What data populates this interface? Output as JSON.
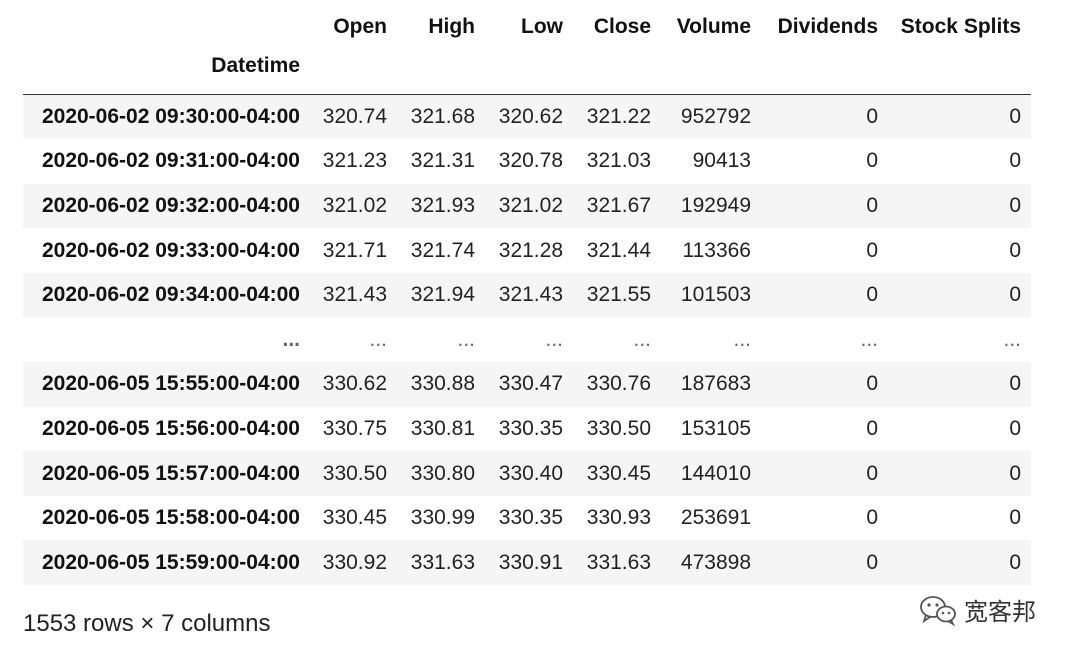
{
  "table": {
    "index_name": "Datetime",
    "columns": [
      "Open",
      "High",
      "Low",
      "Close",
      "Volume",
      "Dividends",
      "Stock Splits"
    ],
    "rows": [
      {
        "index": "2020-06-02 09:30:00-04:00",
        "values": [
          "320.74",
          "321.68",
          "320.62",
          "321.22",
          "952792",
          "0",
          "0"
        ]
      },
      {
        "index": "2020-06-02 09:31:00-04:00",
        "values": [
          "321.23",
          "321.31",
          "320.78",
          "321.03",
          "90413",
          "0",
          "0"
        ]
      },
      {
        "index": "2020-06-02 09:32:00-04:00",
        "values": [
          "321.02",
          "321.93",
          "321.02",
          "321.67",
          "192949",
          "0",
          "0"
        ]
      },
      {
        "index": "2020-06-02 09:33:00-04:00",
        "values": [
          "321.71",
          "321.74",
          "321.28",
          "321.44",
          "113366",
          "0",
          "0"
        ]
      },
      {
        "index": "2020-06-02 09:34:00-04:00",
        "values": [
          "321.43",
          "321.94",
          "321.43",
          "321.55",
          "101503",
          "0",
          "0"
        ]
      },
      {
        "index": "...",
        "values": [
          "...",
          "...",
          "...",
          "...",
          "...",
          "...",
          "..."
        ]
      },
      {
        "index": "2020-06-05 15:55:00-04:00",
        "values": [
          "330.62",
          "330.88",
          "330.47",
          "330.76",
          "187683",
          "0",
          "0"
        ]
      },
      {
        "index": "2020-06-05 15:56:00-04:00",
        "values": [
          "330.75",
          "330.81",
          "330.35",
          "330.50",
          "153105",
          "0",
          "0"
        ]
      },
      {
        "index": "2020-06-05 15:57:00-04:00",
        "values": [
          "330.50",
          "330.80",
          "330.40",
          "330.45",
          "144010",
          "0",
          "0"
        ]
      },
      {
        "index": "2020-06-05 15:58:00-04:00",
        "values": [
          "330.45",
          "330.99",
          "330.35",
          "330.93",
          "253691",
          "0",
          "0"
        ]
      },
      {
        "index": "2020-06-05 15:59:00-04:00",
        "values": [
          "330.92",
          "331.63",
          "330.91",
          "331.63",
          "473898",
          "0",
          "0"
        ]
      }
    ]
  },
  "shape_text": "1553 rows × 7 columns",
  "watermark": {
    "text": "宽客邦",
    "icon": "wechat-icon"
  }
}
